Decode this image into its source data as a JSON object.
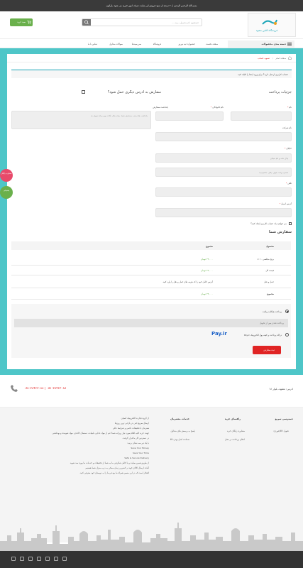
{
  "topbar": {
    "text": "بسم الله الرحمن الرحیم | ۲۰ درصد از سود فروش این سایت صرف امور خیریه می شود. پارکون"
  },
  "header": {
    "logo_text": "فروشگاه آنلاین مشهد",
    "search_placeholder": "جستجوی نام محصول، برند، ...",
    "cart_label": "سبد خرید"
  },
  "nav": {
    "category_label": "دسته بندی محصولات",
    "items": [
      "صفحه نخست",
      "جشنواره عید نوروز",
      "فروشگاه",
      "سررسیدها",
      "سوالات متداول",
      "تماس با ما"
    ]
  },
  "breadcrumb": {
    "home": "صفحه اصلی",
    "current": "تسویه حساب"
  },
  "login_notice": "حساب کاربری از قبل دارید؟ برای ورود اینجا را کلیک کنید",
  "billing": {
    "title": "جزئیات پرداخت",
    "ship_other": "سفارش به آدرس دیگری حمل شود؟",
    "order_notes_label": "یادداشت سفارش",
    "order_notes_placeholder": "یادداشت ها درباره سفارش شما، برای مثال نکات مهم برای تحویل بار",
    "first_name": "نام",
    "last_name": "نام خانوادگی",
    "company": "نام شرکت",
    "street": "خیابان",
    "street_ph1": "پلاک خانه و نام خیابان",
    "street_ph2": "شماره واحد، بلوک، پلاک، (اختیاری)",
    "phone": "تلفن",
    "email": "آدرس ایمیل",
    "create_account": "می خواهید یک حساب کاربری ایجاد کنید؟"
  },
  "order": {
    "title": "سفارش شما",
    "col_product": "محصول",
    "col_total": "مجموع",
    "rows": [
      {
        "label": "برنج مجلسی ۱۰ ×",
        "value": "۳۴,۰۰۰ تومان"
      },
      {
        "label": "قیمت کل",
        "value": "۳۴,۰۰۰ تومان"
      },
      {
        "label": "حمل و نقل",
        "value": "آدرس کامل خود را که هزینه های حمل و نقل را وارد کنید."
      },
      {
        "label": "مجموع",
        "value": "۳۴,۰۰۰ تومان"
      }
    ]
  },
  "payment": {
    "cod_label": "پرداخت هنگام دریافت",
    "cod_desc": "پرداخت نقدی پس از تحویل",
    "payir_label": "درگاه پرداخت و کیف پول الکترونیک Pay.ir",
    "payir_logo": "Pay.ir",
    "submit_label": "ثبت سفارش"
  },
  "side_badges": [
    "مشاوره رایگان",
    "پشتیبانی"
  ],
  "footer": {
    "address": "آدرس: مشهد، بلوار ۱۸",
    "phones": "۰۵۱-۳۸۴۶۳۰۸۸ | ۰۵۱-۳۸۴۶۳۰۸۸",
    "col1_title": "دسترسی سریع",
    "col1_items": [
      "تحویل کالا(فوری)"
    ],
    "col2_title": "راهنمای خرید",
    "col2_items": [
      "مشاوره رایگان خرید",
      "امکان پرداخت در محل"
    ],
    "col3_title": "خدمات مشتریان",
    "col3_items": [
      "پاسخ به پرسش های متداول",
      "ضمانت اصل بودن کالا"
    ],
    "about_lines": [
      "از گروه تجارت الکترونیک آسیان",
      "ارسال سریع حتی در بارانی ترین روزها",
      "همزمان با تخفیفات دائمی و شرایط عالی",
      "جهت خرید کلیه اقلام مورد نیاز روزانه شما اعم از مواد غذایی، لبنیات، دستمال کاغذی، مواد شوینده و بهداشتی",
      "در دسترس کار ما قرار گرفت.",
      "با یک تیر سه نشان بزنید:",
      "Save Your Money",
      "Save Your Time",
      "Safe & Secure Delivery",
      "از طریق همین سایت و با کامل شگرفی ما به شما از تخفیفات و خدمات ما بهره مند شوید",
      "آماده ارسال کالای خود در کمترین زمان ممکن به درب منزل شما هستیم",
      "افتخار است که در این مسیر همراه ما بوده و ما را به دوستان خود معرفی کنید."
    ]
  },
  "colors": {
    "teal": "#4ec6c8",
    "green": "#6ab04c",
    "red": "#e02424",
    "dark": "#333333"
  }
}
